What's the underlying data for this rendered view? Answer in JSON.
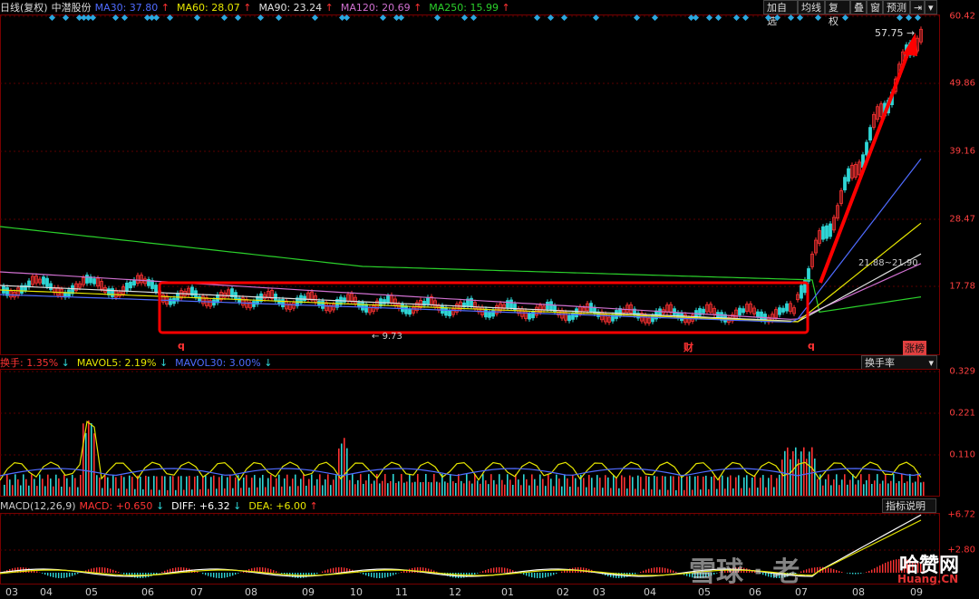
{
  "header": {
    "period": "日线(复权)",
    "stock": "中潜股份",
    "ma": [
      {
        "label": "MA30: 37.80",
        "arrow": "↑",
        "color": "#4f6bff"
      },
      {
        "label": "MA60: 28.07",
        "arrow": "↑",
        "color": "#e6e600"
      },
      {
        "label": "MA90: 23.24",
        "arrow": "↑",
        "color": "#e0e0e0"
      },
      {
        "label": "MA120: 20.69",
        "arrow": "↑",
        "color": "#d070d0"
      },
      {
        "label": "MA250: 15.99",
        "arrow": "↑",
        "color": "#2bd12b"
      }
    ],
    "buttons": [
      "加自选",
      "均线",
      "复权",
      "叠",
      "窗",
      "预测",
      "⇥",
      "▾"
    ]
  },
  "price_axis": [
    "60.42",
    "49.86",
    "39.16",
    "28.47",
    "17.78"
  ],
  "price_labels": {
    "high": "57.75",
    "range": "21.88~21.90",
    "low": "9.73"
  },
  "markers": {
    "q1": "q",
    "cai": "财",
    "q2": "q",
    "zhangbang": "涨榜"
  },
  "turnover": {
    "header": [
      {
        "label": "换手: 1.35%",
        "arrow": "↓",
        "color": "#ff3333"
      },
      {
        "label": "MAVOL5: 2.19%",
        "arrow": "↓",
        "color": "#e6e600"
      },
      {
        "label": "MAVOL30: 3.00%",
        "arrow": "↓",
        "color": "#4f6bff"
      }
    ],
    "select": "换手率",
    "axis": [
      "0.329",
      "0.221",
      "0.110"
    ]
  },
  "macd": {
    "header": [
      {
        "label": "MACD(12,26,9)",
        "color": "#ccc"
      },
      {
        "label": "MACD: +0.650",
        "arrow": "↓",
        "color": "#ff3333"
      },
      {
        "label": "DIFF: +6.32",
        "arrow": "↓",
        "color": "#fff"
      },
      {
        "label": "DEA: +6.00",
        "arrow": "↑",
        "color": "#e6e600"
      }
    ],
    "help": "指标说明",
    "axis": [
      "+6.72",
      "+2.80"
    ]
  },
  "months": [
    "03",
    "04",
    "05",
    "06",
    "07",
    "08",
    "09",
    "10",
    "11",
    "12",
    "01",
    "02",
    "03",
    "04",
    "05",
    "06",
    "07",
    "08",
    "09"
  ],
  "watermark": {
    "text1": "雪球 · 老",
    "text2": "哈赞网",
    "text3": "Huang.CN"
  },
  "colors": {
    "up": "#ff3333",
    "down": "#2fd6d6",
    "frame": "#ff0000",
    "diamond": "#2aa8e0"
  }
}
